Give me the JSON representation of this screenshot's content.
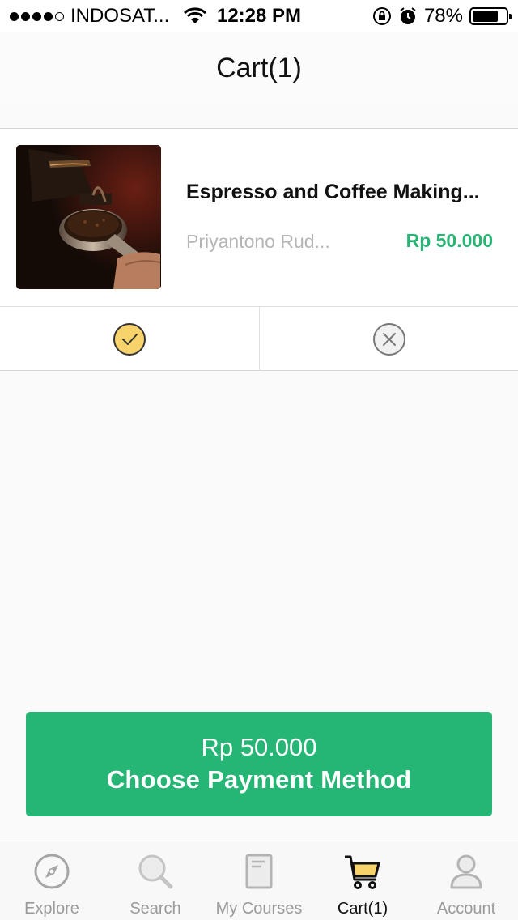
{
  "status_bar": {
    "carrier": "INDOSAT...",
    "time": "12:28 PM",
    "battery_percent": "78%",
    "battery_level": 0.78
  },
  "nav": {
    "title": "Cart(1)"
  },
  "cart_item": {
    "title": "Espresso and Coffee Making...",
    "author": "Priyantono Rud...",
    "price": "Rp 50.000",
    "thumbnail_icon": "espresso-portafilter-image",
    "actions": {
      "confirm_icon": "check-circle-icon",
      "remove_icon": "close-circle-icon"
    }
  },
  "checkout": {
    "total": "Rp 50.000",
    "button_label": "Choose Payment Method"
  },
  "tabs": [
    {
      "label": "Explore",
      "icon": "compass-icon",
      "active": false
    },
    {
      "label": "Search",
      "icon": "search-icon",
      "active": false
    },
    {
      "label": "My Courses",
      "icon": "book-icon",
      "active": false
    },
    {
      "label": "Cart(1)",
      "icon": "cart-icon",
      "active": true
    },
    {
      "label": "Account",
      "icon": "user-icon",
      "active": false
    }
  ],
  "colors": {
    "accent_green": "#25b574",
    "price_green": "#28b474",
    "check_yellow": "#f8d36c",
    "inactive_gray": "#9a9a9a"
  }
}
